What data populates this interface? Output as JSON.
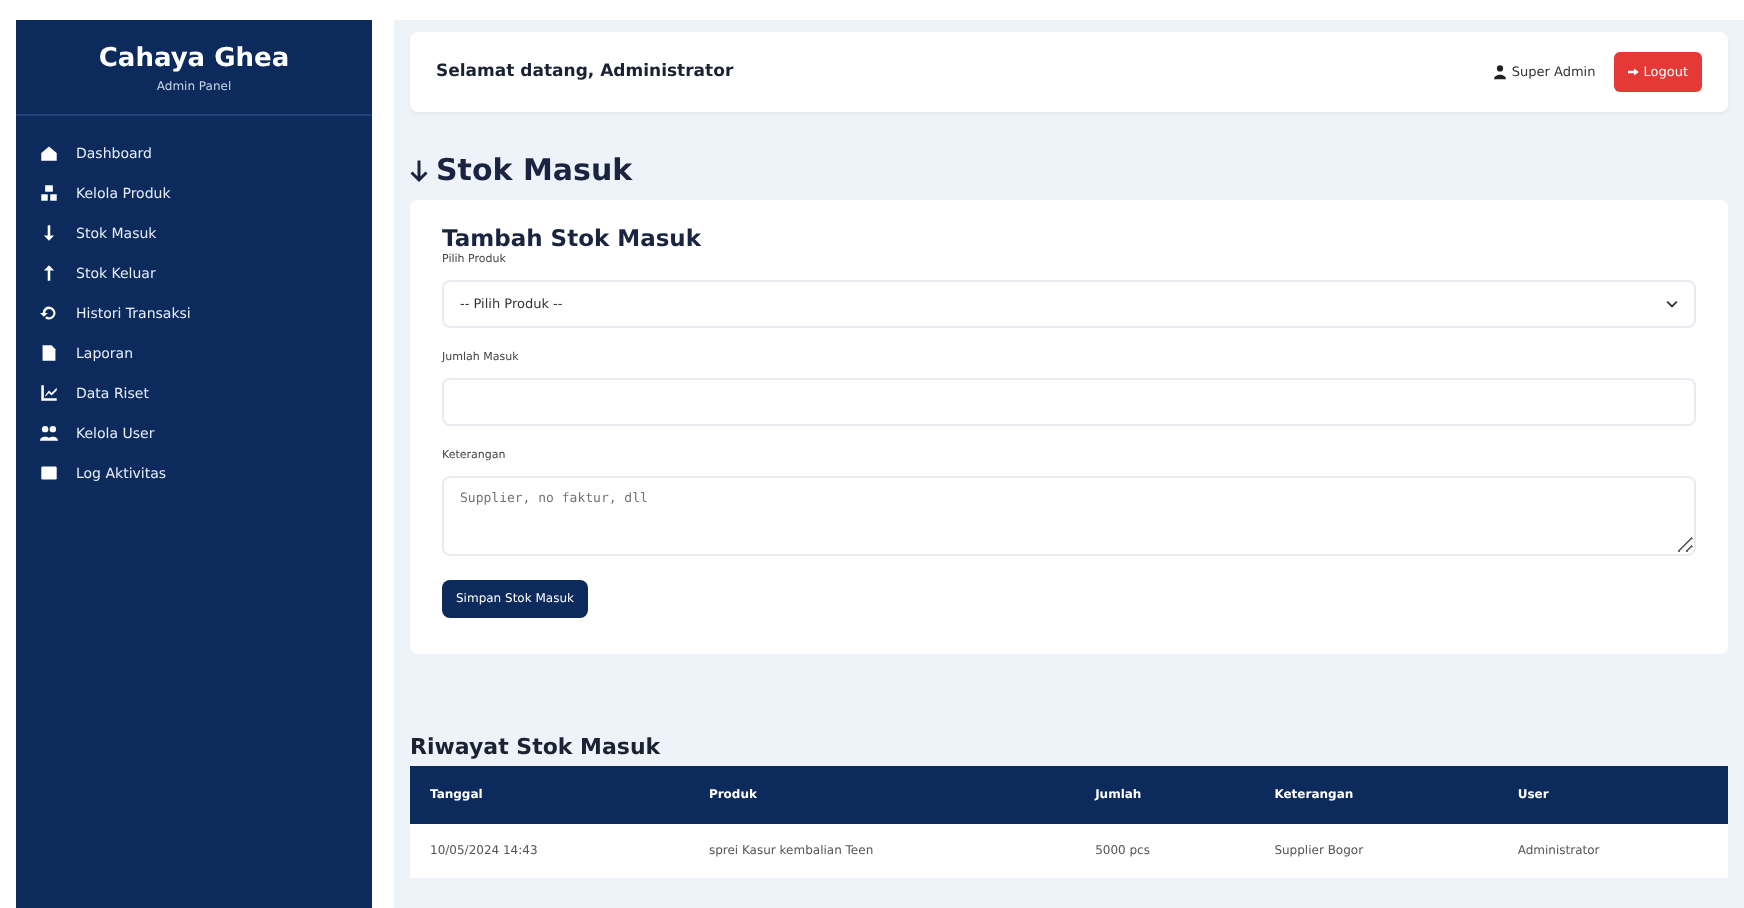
{
  "sidebar": {
    "brand": "Cahaya Ghea",
    "subtitle": "Admin Panel",
    "items": [
      {
        "label": "Dashboard"
      },
      {
        "label": "Kelola Produk"
      },
      {
        "label": "Stok Masuk"
      },
      {
        "label": "Stok Keluar"
      },
      {
        "label": "Histori Transaksi"
      },
      {
        "label": "Laporan"
      },
      {
        "label": "Data Riset"
      },
      {
        "label": "Kelola User"
      },
      {
        "label": "Log Aktivitas"
      }
    ]
  },
  "header": {
    "greeting": "Selamat datang, Administrator",
    "role": "Super Admin",
    "logout": "Logout"
  },
  "page_title": "Stok Masuk",
  "form": {
    "title": "Tambah Stok Masuk",
    "fields": [
      {
        "kind": "select",
        "label": "Pilih Produk",
        "value": "-- Pilih Produk --"
      },
      {
        "kind": "input",
        "label": "Jumlah Masuk"
      },
      {
        "kind": "textarea",
        "label": "Keterangan",
        "placeholder": "Supplier, no faktur, dll"
      }
    ],
    "submit": "Simpan Stok Masuk"
  },
  "history": {
    "title": "Riwayat Stok Masuk",
    "columns": [
      "Tanggal",
      "Produk",
      "Jumlah",
      "Keterangan",
      "User"
    ],
    "rows": [
      [
        "10/05/2024 14:43",
        "sprei Kasur kembalian Teen",
        "5000 pcs",
        "Supplier Bogor",
        "Administrator"
      ]
    ]
  }
}
